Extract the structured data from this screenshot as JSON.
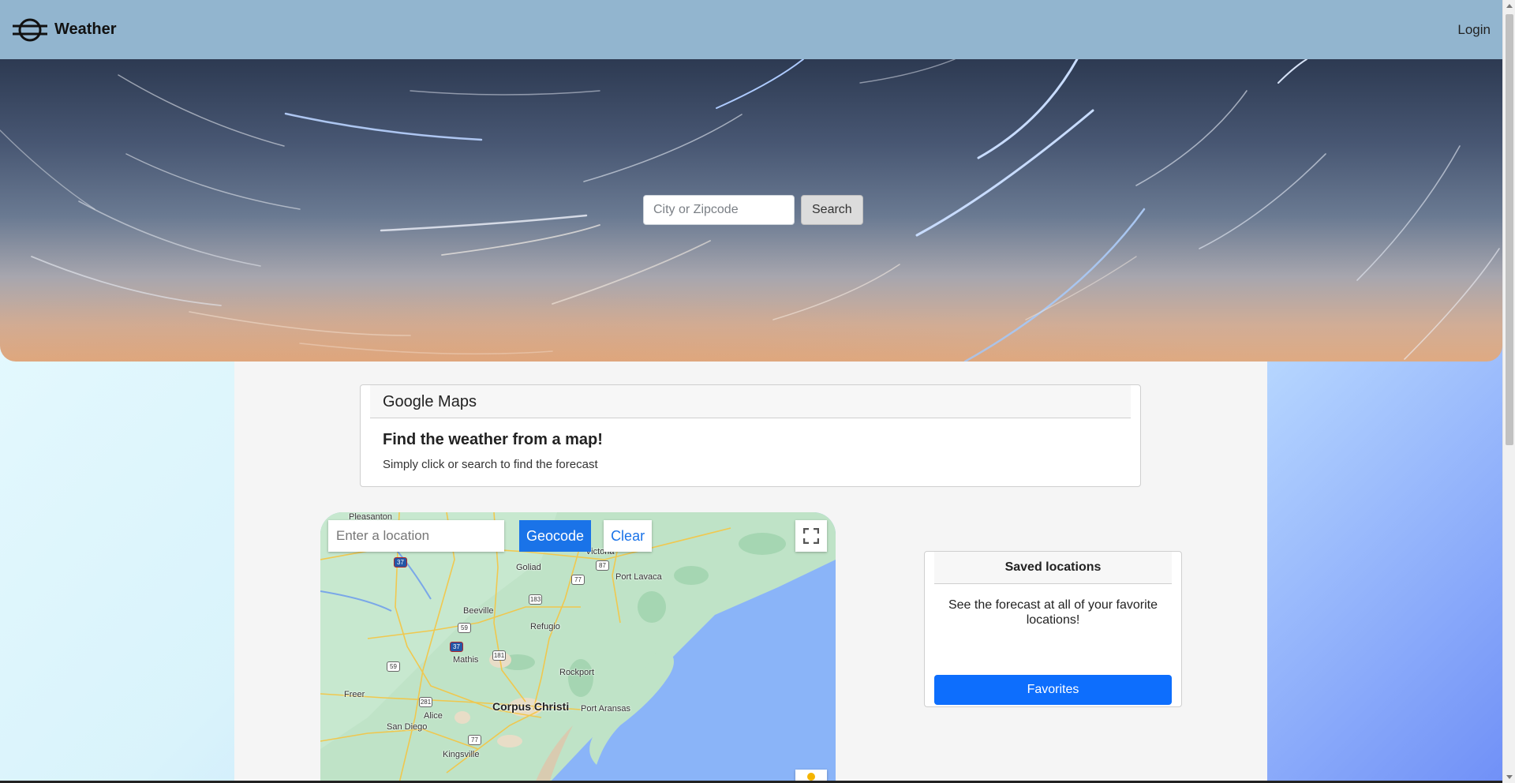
{
  "navbar": {
    "brand_name": "Weather",
    "brand_icon": "planet-ring-logo-icon",
    "login_label": "Login"
  },
  "hero": {
    "search_placeholder": "City or Zipcode",
    "search_label": "Search"
  },
  "maps_card": {
    "header": "Google Maps",
    "title": "Find the weather from a map!",
    "text": "Simply click or search to find the forecast"
  },
  "map": {
    "location_placeholder": "Enter a location",
    "geocode_label": "Geocode",
    "clear_label": "Clear",
    "fullscreen_icon": "fullscreen-icon",
    "places": {
      "pleasanton": "Pleasanton",
      "victoria": "Victoria",
      "goliad": "Goliad",
      "port_lavaca": "Port Lavaca",
      "beeville": "Beeville",
      "refugio": "Refugio",
      "mathis": "Mathis",
      "rockport": "Rockport",
      "freer": "Freer",
      "corpus_christi": "Corpus Christi",
      "port_aransas": "Port Aransas",
      "alice": "Alice",
      "san_diego": "San Diego",
      "kingsville": "Kingsville"
    },
    "highways": {
      "h37a": "37",
      "h87": "87",
      "h77a": "77",
      "h183": "183",
      "h59a": "59",
      "h37b": "37",
      "h181": "181",
      "h59b": "59",
      "h281": "281",
      "h77b": "77"
    }
  },
  "saved_card": {
    "header": "Saved locations",
    "text": "See the forecast at all of your favorite locations!",
    "button_label": "Favorites"
  },
  "colors": {
    "navbar": "#92b5cf",
    "primary_button": "#0d6efd",
    "map_water": "#8ab4f8",
    "map_land": "#bfe3c7"
  }
}
